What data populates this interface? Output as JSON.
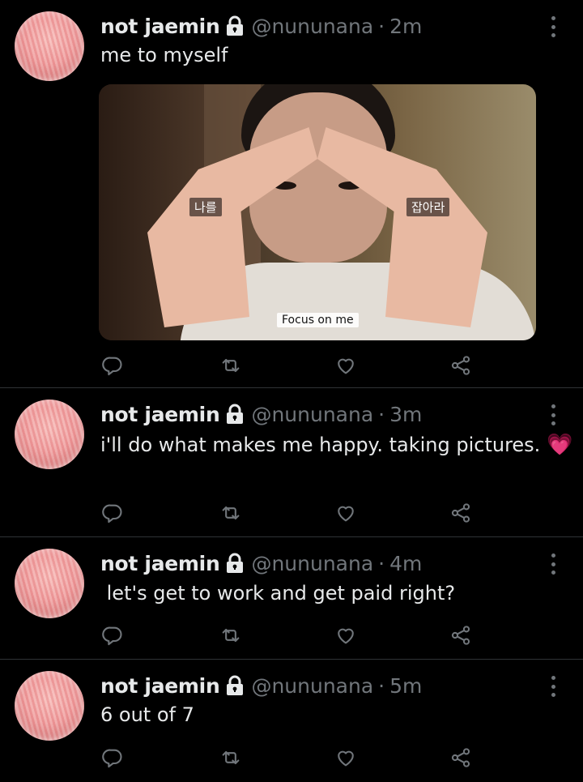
{
  "tweets": [
    {
      "name": "not jaemin",
      "handle": "@nununana",
      "separator": "·",
      "time": "2m",
      "text": "me to myself",
      "media": {
        "caption_left": "나를",
        "caption_right": "잡아라",
        "subtitle": "Focus on me"
      }
    },
    {
      "name": "not jaemin",
      "handle": "@nununana",
      "separator": "·",
      "time": "3m",
      "text": "i'll do what makes me happy. taking pictures.",
      "emoji": "💗"
    },
    {
      "name": "not jaemin",
      "handle": "@nununana",
      "separator": "·",
      "time": "4m",
      "text": " let's get to work and get paid right?"
    },
    {
      "name": "not jaemin",
      "handle": "@nununana",
      "separator": "·",
      "time": "5m",
      "text": "6 out of 7"
    }
  ],
  "icons": {
    "reply": "reply-icon",
    "retweet": "retweet-icon",
    "like": "heart-icon",
    "share": "share-icon",
    "more": "more-icon",
    "lock": "lock-icon"
  },
  "colors": {
    "background": "#000000",
    "text_primary": "#e7e9ea",
    "text_secondary": "#71767b",
    "divider": "#2f3336",
    "avatar_pink": "#ef9c9c"
  }
}
